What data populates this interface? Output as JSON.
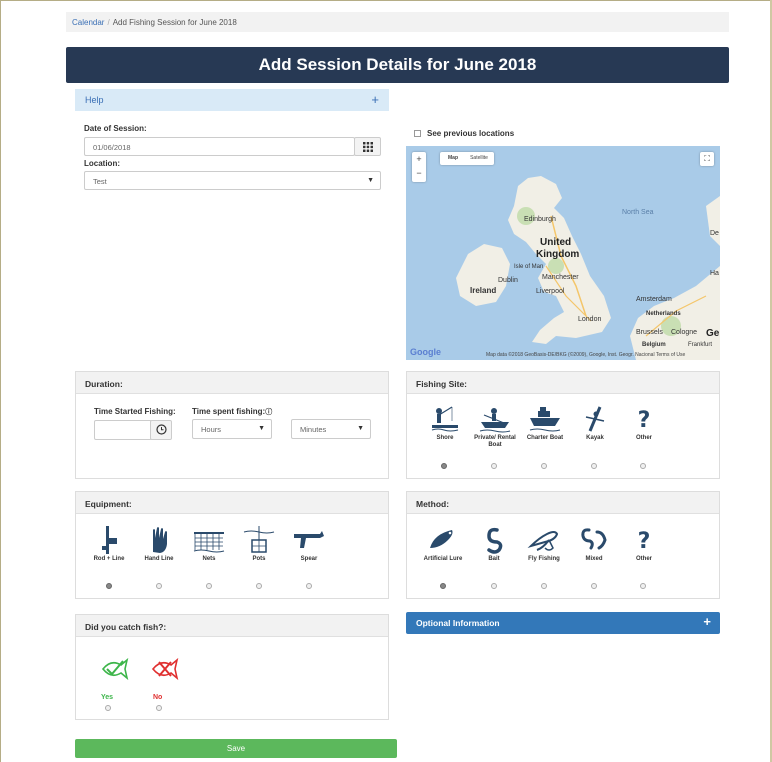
{
  "breadcrumb": {
    "home": "Calendar",
    "separator": "/",
    "current": "Add Fishing Session for June 2018"
  },
  "title": "Add Session Details for June 2018",
  "help": {
    "label": "Help",
    "toggle": "+"
  },
  "date": {
    "label": "Date of Session:",
    "value": "01/06/2018"
  },
  "location": {
    "label": "Location:",
    "value": "Test"
  },
  "map": {
    "prev_label": "See previous locations",
    "type_map": "Map",
    "type_satellite": "Satellite",
    "zoom_in": "+",
    "zoom_out": "−",
    "fullscreen": "⛶",
    "labels": {
      "edinburgh": "Edinburgh",
      "north_sea": "North Sea",
      "uk1": "United",
      "uk2": "Kingdom",
      "isle_of_man": "Isle of Man",
      "dublin": "Dublin",
      "manchester": "Manchester",
      "ireland": "Ireland",
      "liverpool": "Liverpool",
      "london": "London",
      "amsterdam": "Amsterdam",
      "netherlands": "Netherlands",
      "brussels": "Brussels",
      "cologne": "Cologne",
      "belgium": "Belgium",
      "frankfurt": "Frankfurt",
      "ge": "Ge",
      "de": "De",
      "ha": "Ha"
    },
    "google": "Google",
    "footer": "Map data ©2018 GeoBasis-DE/BKG (©2009), Google, Inst. Geogr. Nacional   Terms of Use"
  },
  "duration": {
    "title": "Duration:",
    "started_label": "Time Started Fishing:",
    "spent_label": "Time spent fishing:",
    "hours": "Hours",
    "minutes": "Minutes"
  },
  "fishing_site": {
    "title": "Fishing Site:",
    "options": [
      "Shore",
      "Private/ Rental Boat",
      "Charter Boat",
      "Kayak",
      "Other"
    ],
    "selected": 0
  },
  "equipment": {
    "title": "Equipment:",
    "options": [
      "Rod + Line",
      "Hand Line",
      "Nets",
      "Pots",
      "Spear"
    ],
    "selected": 0
  },
  "method": {
    "title": "Method:",
    "options": [
      "Artificial Lure",
      "Bait",
      "Fly Fishing",
      "Mixed",
      "Other"
    ],
    "selected": 0
  },
  "catch": {
    "title": "Did you catch fish?:",
    "yes": "Yes",
    "no": "No",
    "yes_color": "#3db54a",
    "no_color": "#e03030"
  },
  "optional": {
    "label": "Optional Information",
    "toggle": "+"
  },
  "save": "Save",
  "colors": {
    "title_bar": "#273954",
    "save": "#5cb85c",
    "optional": "#3378b9",
    "help_bg": "#d9eaf7"
  }
}
